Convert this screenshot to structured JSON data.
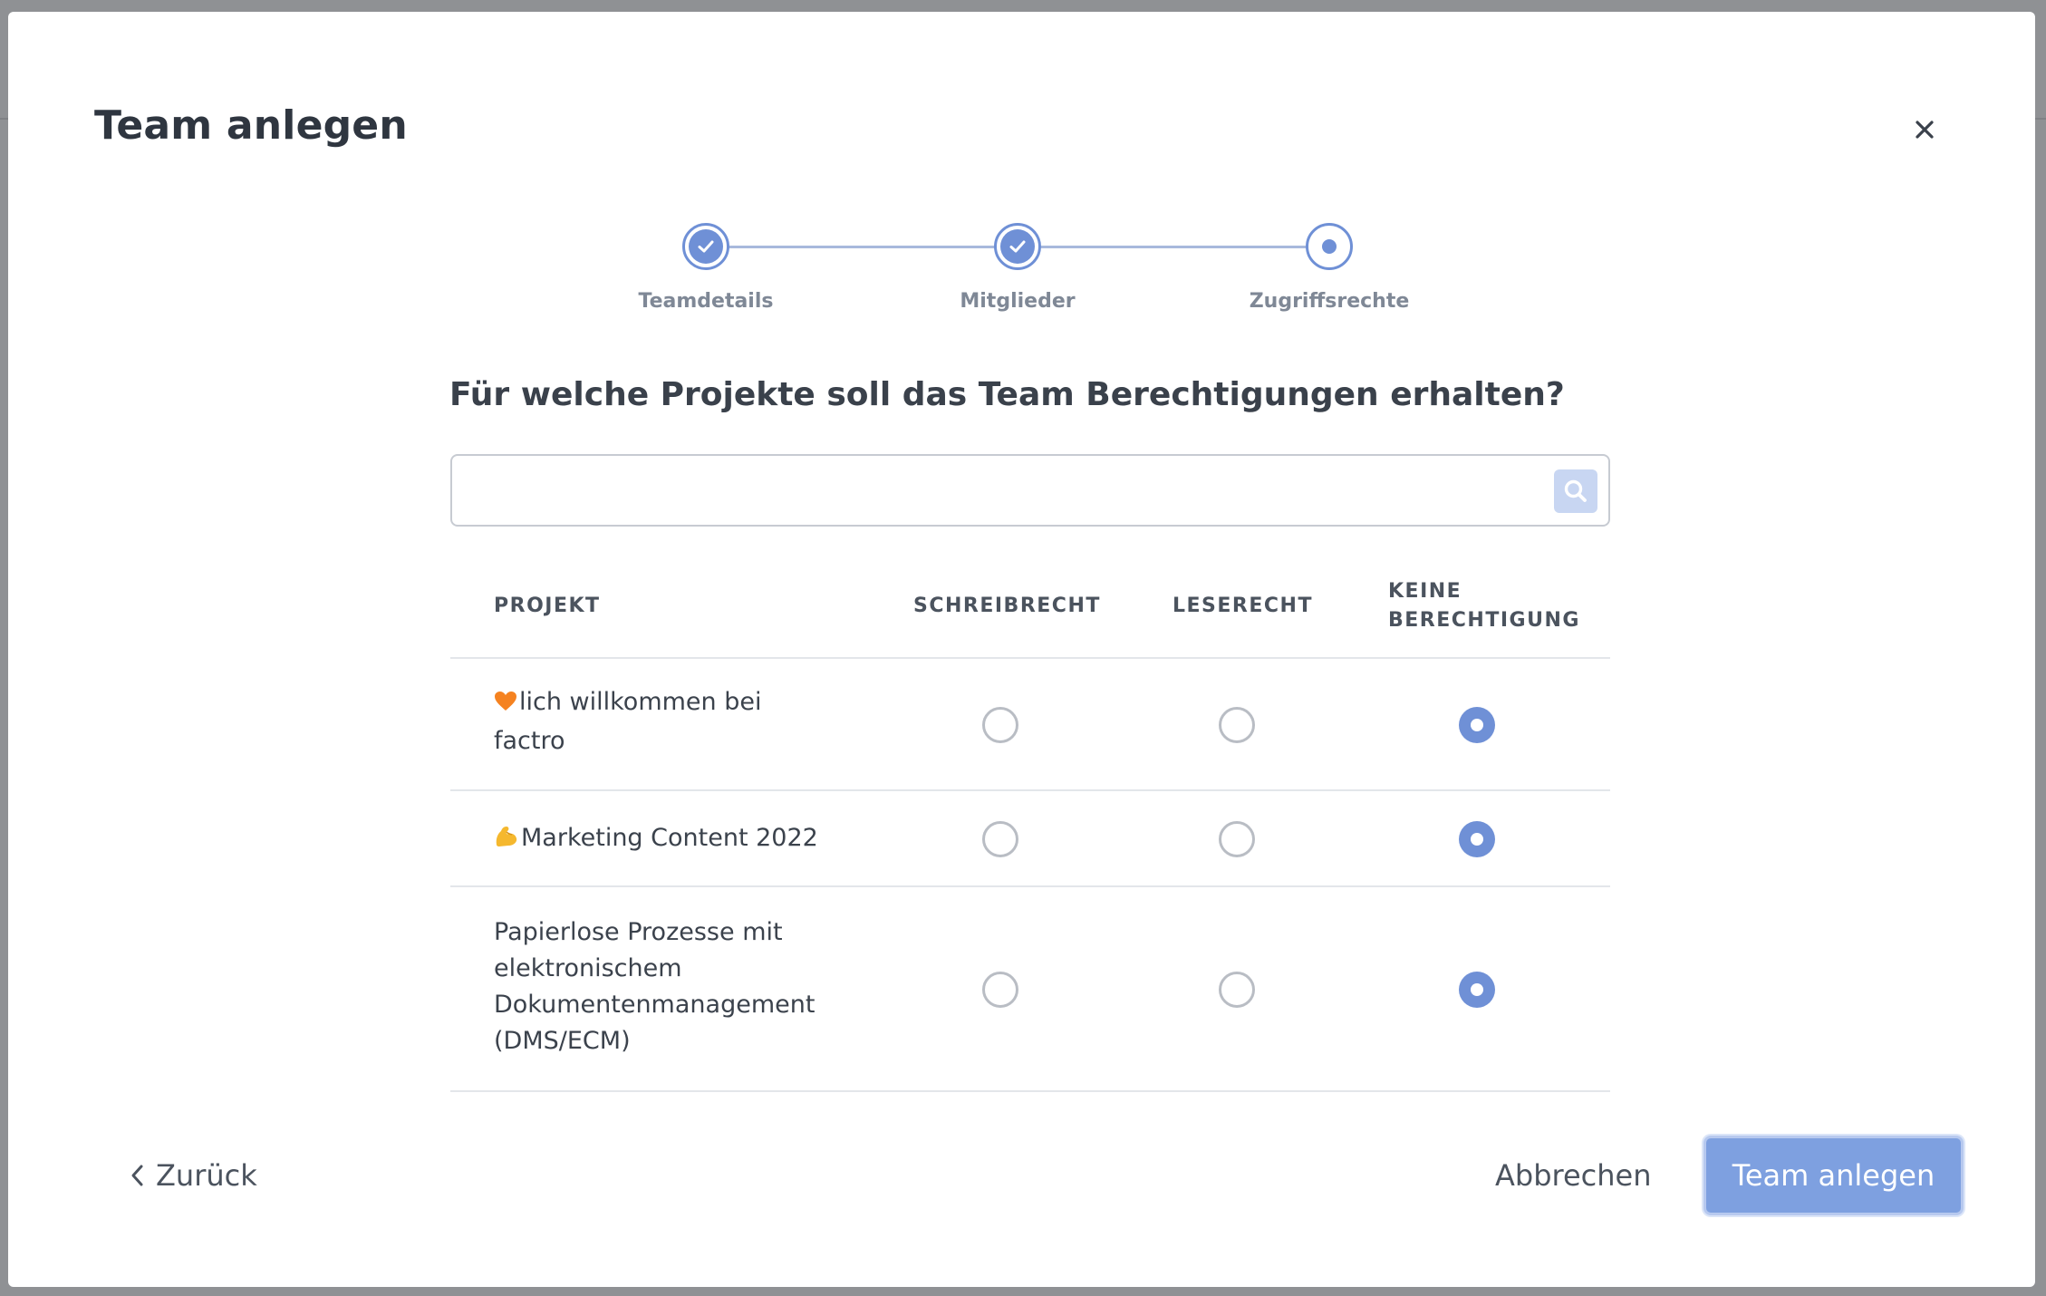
{
  "dialog": {
    "title": "Team anlegen",
    "close_label": "×"
  },
  "stepper": {
    "steps": [
      {
        "label": "Teamdetails",
        "state": "done"
      },
      {
        "label": "Mitglieder",
        "state": "done"
      },
      {
        "label": "Zugriffsrechte",
        "state": "current"
      }
    ]
  },
  "question": "Für welche Projekte soll das Team Berechtigungen erhalten?",
  "search": {
    "value": "",
    "placeholder": ""
  },
  "table": {
    "headers": {
      "project": "PROJEKT",
      "write": "SCHREIBRECHT",
      "read": "LESERECHT",
      "none_line1": "KEINE",
      "none_line2": "BERECHTIGUNG"
    },
    "rows": [
      {
        "name": "lich willkommen bei factro",
        "emoji": "heart",
        "permission": "none"
      },
      {
        "name": "Marketing Content 2022",
        "emoji": "flexed-biceps",
        "permission": "none"
      },
      {
        "name": "Papierlose Prozesse mit elektronischem Dokumentenmanagement (DMS/ECM)",
        "emoji": "",
        "permission": "none"
      }
    ]
  },
  "footer": {
    "back_label": "Zurück",
    "cancel_label": "Abbrechen",
    "submit_label": "Team anlegen"
  },
  "colors": {
    "accent": "#6f90d6",
    "submit": "#7ea0e0",
    "text": "#3b424c"
  }
}
